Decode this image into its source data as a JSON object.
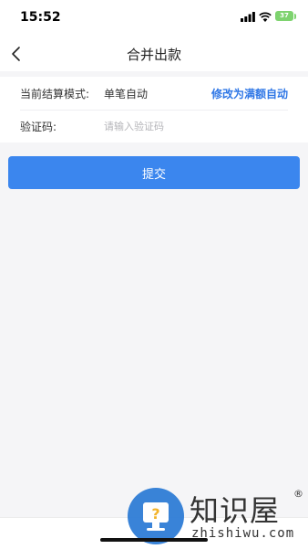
{
  "status_bar": {
    "time": "15:52",
    "battery_level": "37",
    "icons": [
      "signal-icon",
      "wifi-icon",
      "battery-icon"
    ]
  },
  "nav": {
    "title": "合并出款",
    "back_icon": "chevron-left-icon"
  },
  "form": {
    "mode_label": "当前结算模式:",
    "mode_value": "单笔自动",
    "switch_link": "修改为满额自动",
    "code_label": "验证码:",
    "code_value": "",
    "code_placeholder": "请输入验证码"
  },
  "submit_label": "提交",
  "watermark": {
    "title": "知识屋",
    "registered": "®",
    "url": "zhishiwu.com"
  },
  "colors": {
    "accent": "#3b86ee",
    "link": "#2f77e6",
    "background": "#f5f5f7",
    "battery": "#7ed36f"
  }
}
